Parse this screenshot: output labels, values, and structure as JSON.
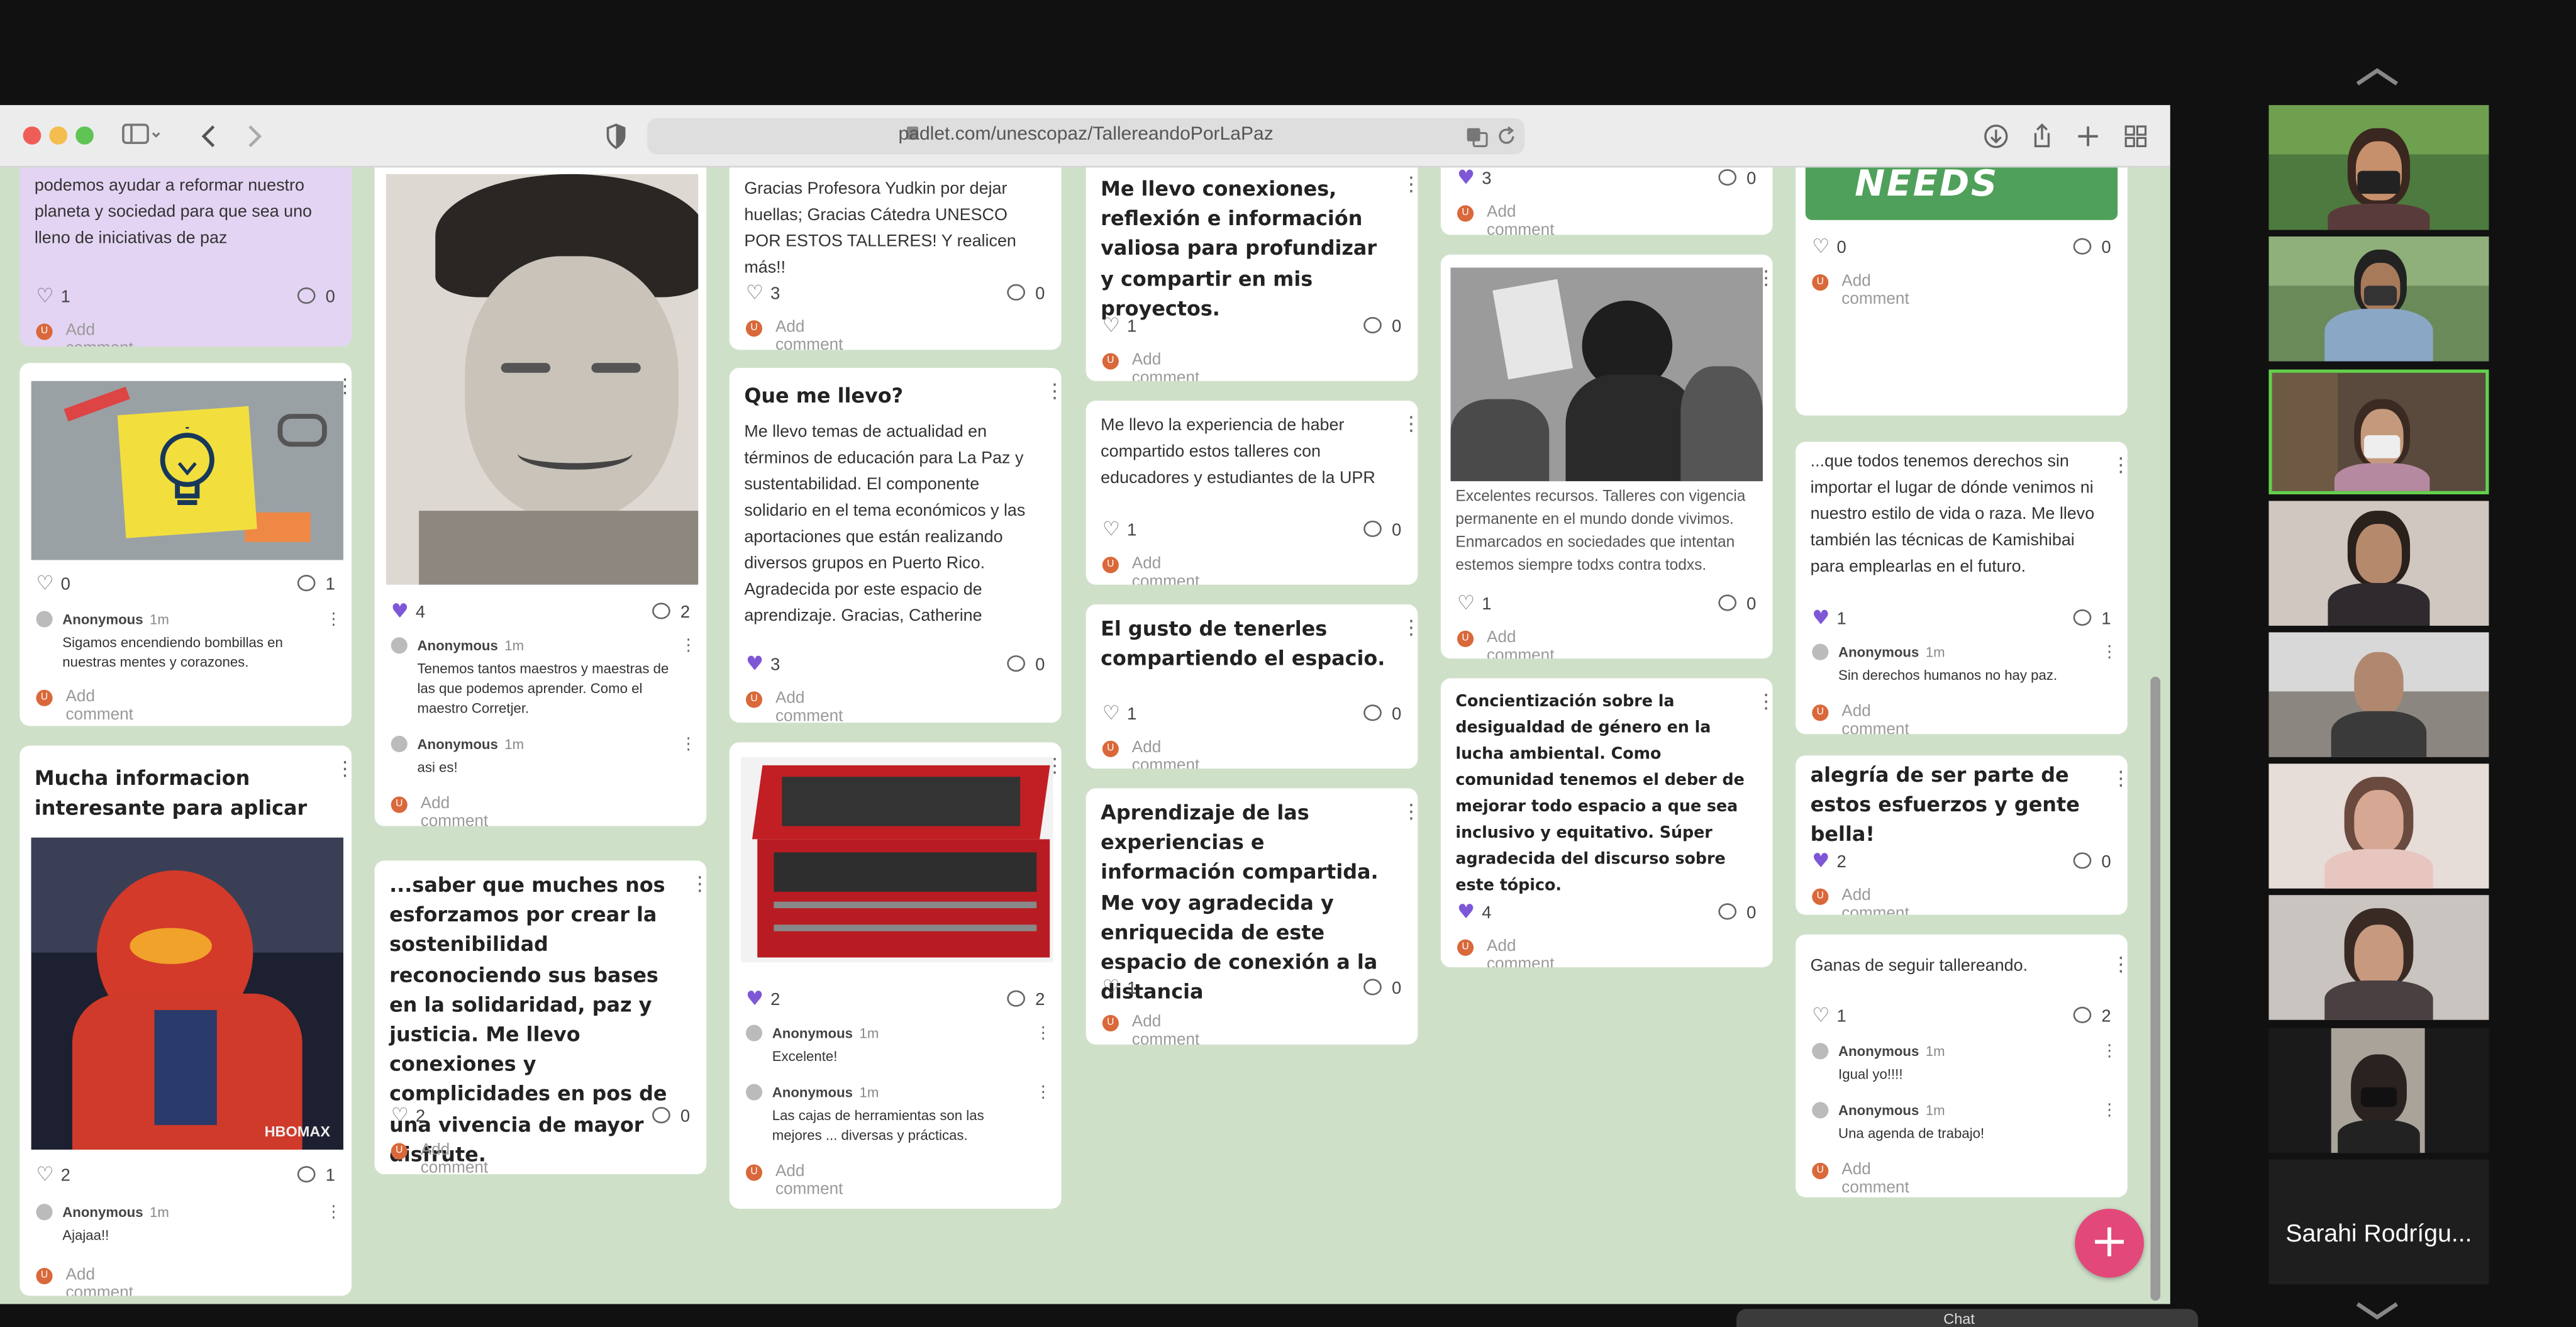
{
  "browser": {
    "url": "padlet.com/unescopaz/TallereandoPorLaPaz"
  },
  "card_ui": {
    "add_comment": "Add comment",
    "avatar_initial": "U",
    "anon": "Anonymous",
    "time": "1m"
  },
  "col1": {
    "c1": {
      "body": "podemos ayudar a reformar nuestro planeta y sociedad para que sea uno lleno de iniciativas de paz",
      "likes": "1",
      "comments": "0"
    },
    "c2": {
      "likes": "0",
      "comments": "1",
      "comment1": "Sigamos encendiendo bombillas en nuestras mentes y corazones."
    },
    "c3": {
      "title": "Mucha informacion interesante para aplicar",
      "likes": "2",
      "comments": "1",
      "comment1": "Ajajaa!!",
      "watermark": "HBOMAX"
    }
  },
  "col2": {
    "c1": {
      "likes": "4",
      "comments": "2",
      "comment1": "Tenemos tantos maestros y maestras de las que podemos aprender. Como el maestro Corretjer.",
      "comment2": "asi es!"
    },
    "c2": {
      "title": "...saber que muches nos esforzamos por crear la sostenibilidad reconociendo sus bases en la solidaridad, paz y justicia. Me llevo conexiones y complicidades en pos de una vivencia de mayor disfrute.",
      "likes": "2",
      "comments": "0"
    }
  },
  "col3": {
    "c1": {
      "body": "Gracias Profesora Yudkin por dejar huellas; Gracias Cátedra UNESCO POR ESTOS TALLERES! Y realicen más!!",
      "likes": "3",
      "comments": "0"
    },
    "c2": {
      "title": "Que me llevo?",
      "body": "Me llevo temas de actualidad en términos de educación para La Paz y sustentabilidad. El componente solidario en el tema económicos y las aportaciones que están realizando diversos grupos en Puerto Rico. Agradecida por este espacio de aprendizaje. Gracias, Catherine",
      "likes": "3",
      "comments": "0"
    },
    "c3": {
      "likes": "2",
      "comments": "2",
      "comment1": "Excelente!",
      "comment2": "Las cajas de herramientas son las mejores ... diversas y prácticas."
    }
  },
  "col4": {
    "c1": {
      "title": "Me llevo conexiones, reflexión e información valiosa para profundizar y compartir en mis proyectos.",
      "likes": "1",
      "comments": "0"
    },
    "c2": {
      "body": "Me llevo la experiencia de haber compartido estos talleres con educadores y estudiantes de la UPR",
      "likes": "1",
      "comments": "0"
    },
    "c3": {
      "title": "El gusto de tenerles compartiendo el espacio.",
      "likes": "1",
      "comments": "0"
    },
    "c4": {
      "title": "Aprendizaje de las experiencias e información compartida. Me voy agradecida y enriquecida de este espacio de conexión a la distancia",
      "likes": "1",
      "comments": "0"
    }
  },
  "col5": {
    "c1": {
      "likes": "3",
      "comments": "0"
    },
    "c2": {
      "body": "Excelentes recursos. Talleres con vigencia permanente en el mundo donde vivimos. Enmarcados en sociedades que intentan estemos siempre todxs contra todxs.",
      "likes": "1",
      "comments": "0"
    },
    "c3": {
      "body": "Concientización sobre la desigualdad de género en la lucha ambiental. Como comunidad tenemos el deber de mejorar todo espacio a que sea inclusivo y equitativo. Súper agradecida del discurso sobre este tópico.",
      "likes": "4",
      "comments": "0"
    }
  },
  "col6": {
    "c1": {
      "banner": "NEEDS",
      "likes": "0",
      "comments": "0"
    },
    "c2": {
      "body": "...que todos tenemos derechos sin importar el lugar de dónde venimos ni nuestro estilo de vida o raza. Me llevo también las técnicas de Kamishibai para emplearlas en el futuro.",
      "likes": "1",
      "comments": "1",
      "comment1": "Sin derechos humanos no hay paz."
    },
    "c3": {
      "title": "alegría de ser parte de estos esfuerzos y gente bella!",
      "likes": "2",
      "comments": "0"
    },
    "c4": {
      "body": "Ganas de seguir tallereando.",
      "likes": "1",
      "comments": "2",
      "comment1": "Igual yo!!!!",
      "comment2": "Una agenda de trabajo!"
    }
  },
  "zoom": {
    "last_name": "Sarahi Rodrígu...",
    "chat_label": "Chat"
  },
  "colors": {
    "board_bg": "#cfe0c9",
    "heart_active": "#7e57d6",
    "fab": "#e3487a",
    "active_speaker": "#63d04c"
  }
}
